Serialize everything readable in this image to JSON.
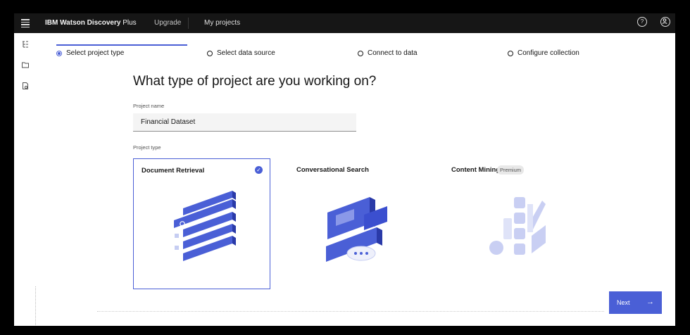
{
  "header": {
    "brand": "IBM Watson Discovery",
    "brand_suffix": "Plus",
    "nav_upgrade": "Upgrade",
    "nav_projects": "My projects",
    "help_icon": "help-icon",
    "user_icon": "user-icon"
  },
  "steps": [
    {
      "label": "Select project type",
      "state": "active"
    },
    {
      "label": "Select data source",
      "state": "inactive"
    },
    {
      "label": "Connect to data",
      "state": "inactive"
    },
    {
      "label": "Configure collection",
      "state": "inactive"
    }
  ],
  "page": {
    "title": "What type of project are you working on?",
    "project_name_label": "Project name",
    "project_name_value": "Financial Dataset",
    "project_type_label": "Project type"
  },
  "cards": [
    {
      "title": "Document Retrieval",
      "selected": true
    },
    {
      "title": "Conversational Search",
      "selected": false
    },
    {
      "title": "Content Mining",
      "badge": "Premium",
      "selected": false
    }
  ],
  "footer": {
    "next_label": "Next"
  },
  "colors": {
    "accent": "#4a5fd6",
    "topbar": "#161616"
  }
}
